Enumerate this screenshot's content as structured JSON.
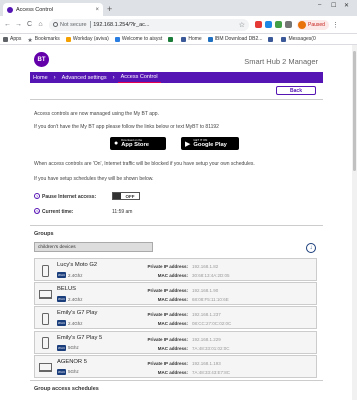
{
  "browser": {
    "tab_title": "Access Control",
    "tab_close": "×",
    "new_tab": "+",
    "window_controls": [
      "–",
      "☐",
      "✕"
    ],
    "nav": [
      "←",
      "→",
      "C",
      "⌂"
    ],
    "not_secure": "Not secure",
    "url": "192.168.1.254/?lr_ac...",
    "paused_label": "Paused",
    "bookmarks": [
      {
        "label": "Apps",
        "color": "#5f6368"
      },
      {
        "label": "Bookmarks",
        "color": "#5f6368",
        "icon": "star-icon"
      },
      {
        "label": "Workday (aviva)",
        "color": "#f4a100"
      },
      {
        "label": "Welcome to aisyst",
        "color": "#2a7de1"
      },
      {
        "label": "",
        "color": "#1c7c3a"
      },
      {
        "label": "Home",
        "color": "#3b5998"
      },
      {
        "label": "IBM Download DB2...",
        "color": "#1f70c1"
      },
      {
        "label": "",
        "color": "#3b5998"
      },
      {
        "label": "Messages(0",
        "color": "#3b5998"
      }
    ]
  },
  "header": {
    "logo_text": "BT",
    "product": "Smart Hub 2 Manager"
  },
  "nav": {
    "items": [
      "Home",
      "Advanced settings",
      "Access Control"
    ]
  },
  "back_label": "Back",
  "intro": {
    "line1": "Access controls are now managed using the My BT app.",
    "line2": "If you don't have the My BT app please follow the links below or text MyBT to 81192",
    "app_store": {
      "small": "Download on the",
      "big": "App Store"
    },
    "google_play": {
      "small": "GET IT ON",
      "big": "Google Play"
    },
    "line3": "When access controls are 'On', Internet traffic will be blocked if you have setup your own schedules.",
    "line4": "If you have setup schedules they will be shown below."
  },
  "pause": {
    "label": "Pause Internet access:",
    "toggle": "OFF"
  },
  "current_time": {
    "label": "Current time:",
    "value": "11:59 am"
  },
  "groups": {
    "heading": "Groups",
    "selected": "children's devices"
  },
  "devices": [
    {
      "name": "Lucy's Moto G2",
      "type": "phone",
      "band": "2.4Ghz",
      "ip": "192.168.1.82",
      "mac": "30:68:13:4A:2D:05"
    },
    {
      "name": "BELUS",
      "type": "laptop",
      "band": "2.4Ghz",
      "ip": "192.168.1.90",
      "mac": "68:08:F5:11:10:6E"
    },
    {
      "name": "Emily's G7 Play",
      "type": "phone",
      "band": "2.4Ghz",
      "ip": "192.168.1.237",
      "mac": "08:CC:27:0C:02:0C"
    },
    {
      "name": "Emily's G7 Play 5",
      "type": "phone",
      "band": "5Ghz",
      "ip": "192.168.1.229",
      "mac": "7A:48:33:01:02:0C"
    },
    {
      "name": "AGENOR 5",
      "type": "laptop",
      "band": "5Ghz",
      "ip": "192.168.1.193",
      "mac": "7A:48:33:43:E7:8C"
    }
  ],
  "device_labels": {
    "ip": "Private IP address:",
    "mac": "MAC address:",
    "wifi": "Wi-Fi"
  },
  "schedules_heading": "Group access schedules",
  "colors": {
    "brand": "#5514b4",
    "active_underline": "#e60050"
  }
}
